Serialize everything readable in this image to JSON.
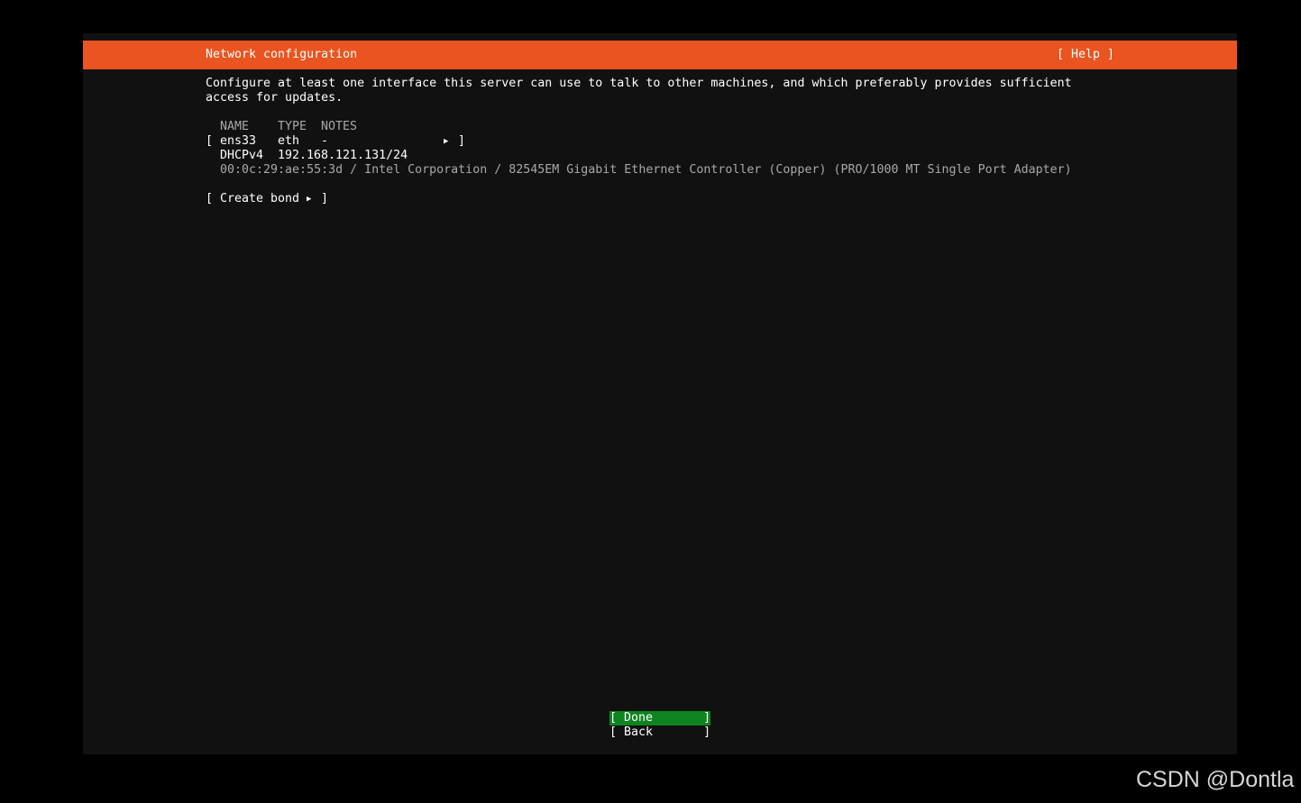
{
  "header": {
    "title": "Network configuration",
    "help_label": "[ Help ]"
  },
  "intro": {
    "line1": "Configure at least one interface this server can use to talk to other machines, and which preferably provides sufficient",
    "line2": "access for updates."
  },
  "table": {
    "columns": [
      "NAME",
      "TYPE",
      "NOTES"
    ],
    "interfaces": [
      {
        "open_bracket": "[",
        "name": "ens33",
        "type": "eth",
        "notes": "-",
        "arrow": "▶",
        "close_bracket": "]",
        "address_method": "DHCPv4",
        "address": "192.168.121.131/24",
        "hardware": "00:0c:29:ae:55:3d / Intel Corporation / 82545EM Gigabit Ethernet Controller (Copper) (PRO/1000 MT Single Port Adapter)"
      }
    ]
  },
  "create_bond": {
    "open_bracket": "[",
    "label": "Create bond",
    "arrow": "▶",
    "close_bracket": "]"
  },
  "footer": {
    "done_label": "[ Done       ]",
    "back_label": "[ Back       ]"
  },
  "colors": {
    "accent": "#e95420",
    "selected": "#0e8420",
    "background": "#111111"
  },
  "watermark": "CSDN @Dontla"
}
